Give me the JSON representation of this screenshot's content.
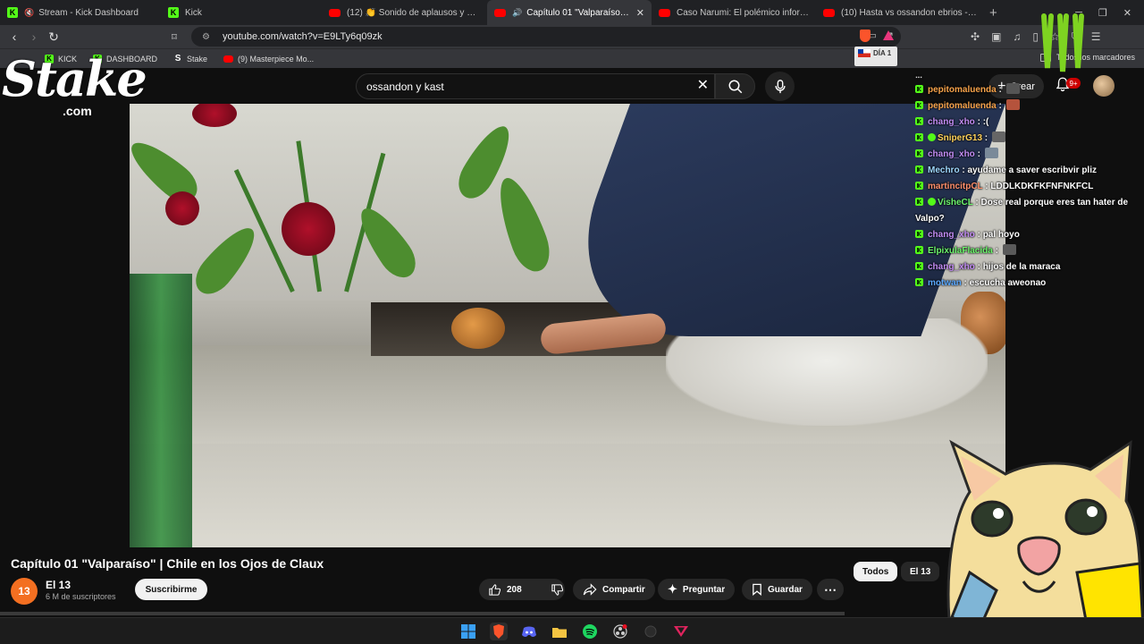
{
  "tabs": [
    {
      "label": "Stream - Kick Dashboard",
      "icon": "kick-icon"
    },
    {
      "label": "Kick",
      "icon": "kick-icon"
    },
    {
      "label": "(12) 👏 Sonido de aplausos y gritos",
      "icon": "youtube-icon"
    },
    {
      "label": "Capítulo 01 \"Valparaíso\" | Chile",
      "icon": "youtube-icon",
      "active": true
    },
    {
      "label": "Caso Narumi: El polémico informe pr",
      "icon": "youtube-icon"
    },
    {
      "label": "(10) Hasta vs ossandon ebrios - YouT",
      "icon": "youtube-icon"
    }
  ],
  "address": {
    "url": "youtube.com/watch?v=E9LTy6q09zk"
  },
  "bookmarks": [
    {
      "label": "KICK",
      "icon": "kick-icon"
    },
    {
      "label": "DASHBOARD",
      "icon": "kick-icon"
    },
    {
      "label": "Stake",
      "icon": "stake-icon"
    },
    {
      "label": "(9) Masterpiece Mo...",
      "icon": "youtube-icon"
    }
  ],
  "bookmarks_all": "Todos los marcadores",
  "overlay": {
    "stake_word": "Stake",
    "stake_com": ".com"
  },
  "youtube": {
    "search_value": "ossandon y kast",
    "create_label": "Crear",
    "bell_badge": "9+"
  },
  "chat": [
    {
      "user": "pepitomaluenda",
      "color": "#f7a34a",
      "text": "",
      "emote": "#555555"
    },
    {
      "user": "pepitomaluenda",
      "color": "#f7a34a",
      "text": "",
      "emote": "#b5533c"
    },
    {
      "user": "chang_xho",
      "color": "#c38df5",
      "text": ":("
    },
    {
      "user": "SniperG13",
      "color": "#ffd25a",
      "text": "",
      "emote": "#666666",
      "subbadge": true
    },
    {
      "user": "chang_xho",
      "color": "#c38df5",
      "text": "",
      "emote": "#7a8a99"
    },
    {
      "user": "Mechro",
      "color": "#9fd8ff",
      "text": "ayudame a saver escribvir pliz"
    },
    {
      "user": "martincitpCL",
      "color": "#ff8f6b",
      "text": "LDDLKDKFKFNFNKFCL"
    },
    {
      "user": "VisheCL",
      "color": "#6cf56c",
      "text": "Dose real porque eres tan hater de Valpo?",
      "subbadge": true
    },
    {
      "user": "chang_xho",
      "color": "#c38df5",
      "text": "pal hoyo"
    },
    {
      "user": "ElpixulaFlacida",
      "color": "#6cf56c",
      "text": "",
      "emote": "#5a5a5a"
    },
    {
      "user": "chang_xho",
      "color": "#c38df5",
      "text": "hijos de la maraca"
    },
    {
      "user": "motwan",
      "color": "#5aa8ff",
      "text": "escucha aweonao"
    }
  ],
  "video": {
    "title": "Capítulo 01 \"Valparaíso\" | Chile en los Ojos de Claux",
    "channel": "El 13",
    "channel_avatar": "13",
    "subscribers": "6 M de suscriptores",
    "subscribe_label": "Suscribirme",
    "likes": "208",
    "share_label": "Compartir",
    "ask_label": "Preguntar",
    "save_label": "Guardar"
  },
  "chips": {
    "all": "Todos",
    "channel": "El 13"
  },
  "day_badge": "DÍA 1",
  "colors": {
    "kick": "#53fc18",
    "youtube_red": "#ff0000",
    "brave": "#fb542b"
  }
}
